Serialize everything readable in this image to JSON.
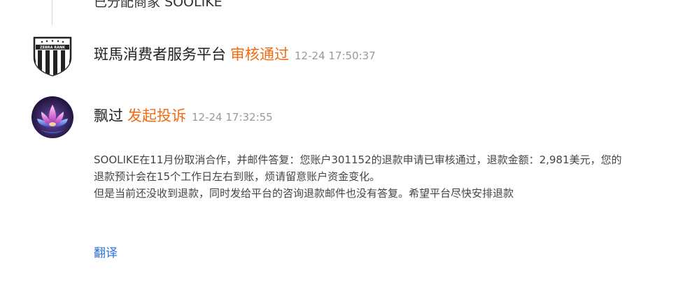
{
  "top_notice": {
    "text": "已分配商家 SOOLIKE"
  },
  "entries": [
    {
      "name": "斑馬消费者服务平台",
      "status": "审核通过",
      "time": "12-24 17:50:37",
      "avatar_icon": "zebra-rank-shield-icon",
      "avatar_text": "ZEBRA RANK"
    },
    {
      "name": "飘过",
      "status": "发起投诉",
      "time": "12-24 17:32:55",
      "avatar_icon": "lotus-flower-icon"
    }
  ],
  "complaint": {
    "lines": [
      "SOOLIKE在11月份取消合作，并邮件答复：您账户301152的退款申请已审核通过，退款金额：2,981美元，您的",
      "退款预计会在15个工作日左右到账，烦请留意账户资金变化。",
      "但是当前还没收到退款，同时发给平台的咨询退款邮件也没有答复。希望平台尽快安排退款"
    ]
  },
  "translate_label": "翻译",
  "colors": {
    "status": "#f26a12",
    "link": "#2a6fd6",
    "time": "#999999"
  }
}
